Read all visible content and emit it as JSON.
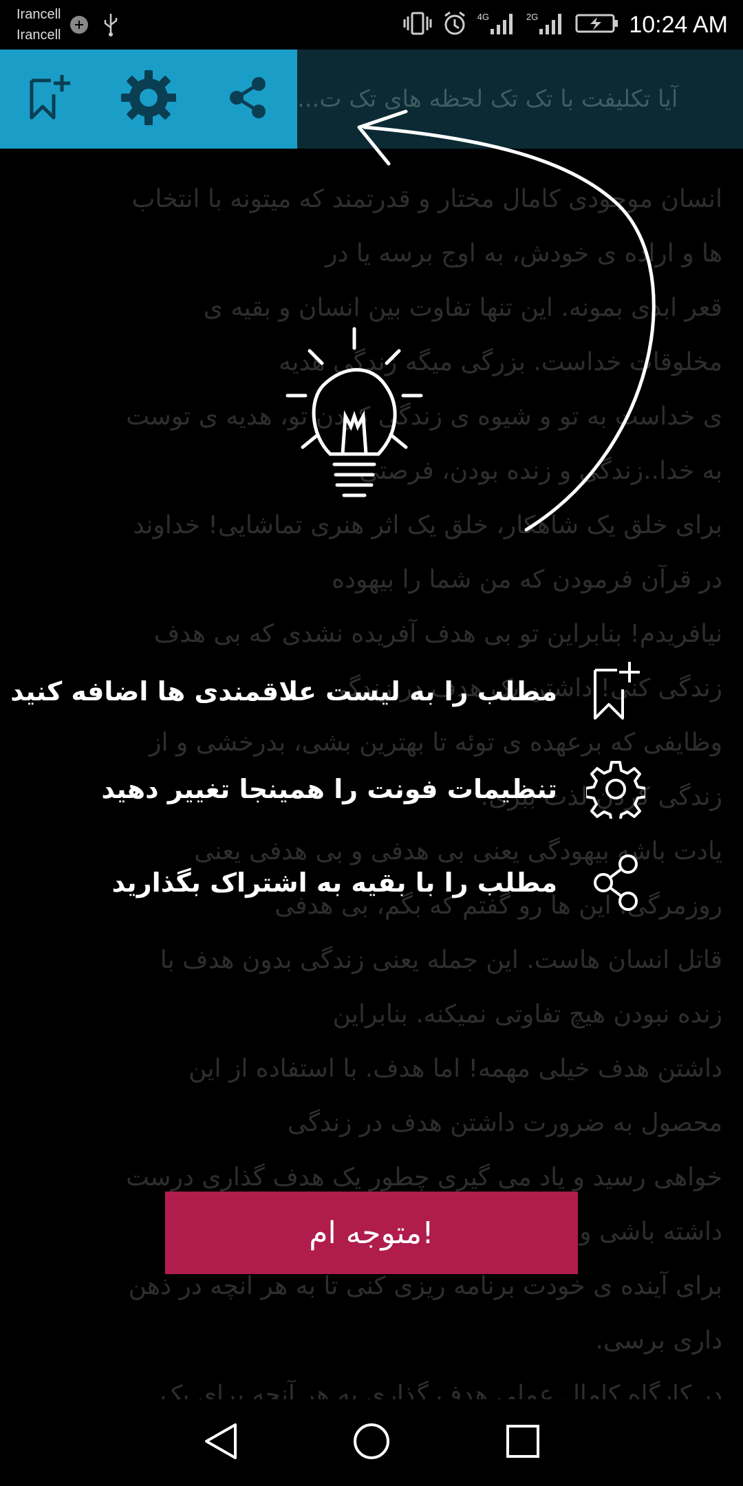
{
  "status_bar": {
    "carrier_1": "Irancell",
    "carrier_2": "Irancell",
    "net_1": "4G",
    "net_2": "2G",
    "time": "10:24 AM"
  },
  "toolbar": {
    "title": "آیا تکلیفت با تک تک لحظه های تک ت...",
    "icons": [
      "bookmark-add-icon",
      "gear-icon",
      "share-icon"
    ],
    "accent_color": "#1a9ec8"
  },
  "article": {
    "lines": [
      "انسان موجودی کامال مختار و قدرتمند که میتونه با انتخاب",
      "ها و اراده ی خودش، به اوج برسه یا در",
      "قعر ابدی بمونه. این تنها تفاوت بین انسان و بقیه ی",
      "مخلوقات خداست. بزرگی میگه زندگی هدیه",
      "ی خداست به تو و شیوه ی زندگی کردن تو، هدیه ی توست",
      "به خدا..زندگی و زنده بودن، فرصتی",
      "برای خلق یک شاهکار، خلق یک اثر هنری تماشایی! خداوند",
      "در قرآن فرمودن که من شما را بیهوده",
      "نیافریدم! بنابراین تو بی هدف آفریده نشدی که بی هدف",
      "زندگی کنی! داشتن یک هدف در زندگی",
      "وظایفی که برعهده ی توئه تا بهترین بشی، بدرخشی و از",
      "زندگی کردن لذت ببری.",
      "یادت باشه بیهودگی یعنی بی هدفی و بی هدفی یعنی",
      "روزمرگی. این ها رو گفتم که بگم، بی هدفی",
      "قاتل انسان هاست. این جمله یعنی زندگی بدون هدف با",
      "زنده نبودن هیچ تفاوتی نمیکنه. بنابراین",
      "داشتن هدف خیلی مهمه! اما هدف. با استفاده از این",
      "محصول به ضرورت داشتن هدف در زندگی",
      "خواهی رسید و یاد می گیری چطور یک هدف گذاری درست",
      "داشته باشی و",
      "برای آینده ی خودت برنامه ریزی کنی تا به هر انچه در ذهن",
      "داری برسی.",
      "در کارگاه کامال عملی هدف گذاری به هر آنچه برای یک"
    ]
  },
  "hints": [
    {
      "icon": "bookmark-add-icon",
      "text": "مطلب را به لیست علاقمندی ها اضافه کنید"
    },
    {
      "icon": "gear-icon",
      "text": "تنظیمات فونت را همینجا تغییر دهید"
    },
    {
      "icon": "share-icon",
      "text": "مطلب را با بقیه به اشتراک بگذارید"
    }
  ],
  "got_it_label": "متوجه ام!",
  "got_it_color": "#b01d4d",
  "nav": [
    "back-icon",
    "home-icon",
    "recents-icon"
  ]
}
